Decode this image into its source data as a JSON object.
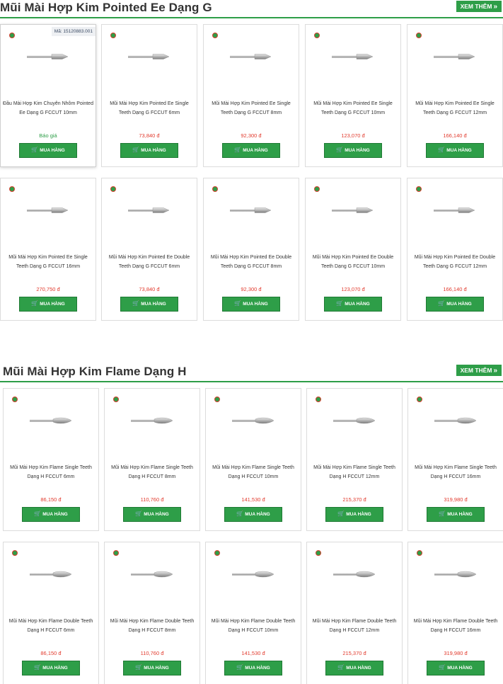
{
  "sections": [
    {
      "title": "Mũi Mài Hợp Kim Pointed Ee Dạng G",
      "see_more": "XEM THÊM",
      "products": [
        {
          "name": "Đầu Mài Hợp Kim Chuyên Nhôm Pointed Ee Dạng G FCCUT 10mm",
          "price": "Báo giá",
          "sku": "Mã: 15120883.001"
        },
        {
          "name": "Mũi Mài Hợp Kim Pointed Ee Single Teeth Dạng G FCCUT 6mm",
          "price": "73,840 đ"
        },
        {
          "name": "Mũi Mài Hợp Kim Pointed Ee Single Teeth Dạng G FCCUT 8mm",
          "price": "92,300 đ"
        },
        {
          "name": "Mũi Mài Hợp Kim Pointed Ee Single Teeth Dạng G FCCUT 10mm",
          "price": "123,070 đ"
        },
        {
          "name": "Mũi Mài Hợp Kim Pointed Ee Single Teeth Dạng G FCCUT 12mm",
          "price": "166,140 đ"
        },
        {
          "name": "Mũi Mài Hợp Kim Pointed Ee Single Teeth Dạng G FCCUT 16mm",
          "price": "270,750 đ"
        },
        {
          "name": "Mũi Mài Hợp Kim Pointed Ee Double Teeth Dạng G FCCUT 6mm",
          "price": "73,840 đ"
        },
        {
          "name": "Mũi Mài Hợp Kim Pointed Ee Double Teeth Dạng G FCCUT 8mm",
          "price": "92,300 đ"
        },
        {
          "name": "Mũi Mài Hợp Kim Pointed Ee Double Teeth Dạng G FCCUT 10mm",
          "price": "123,070 đ"
        },
        {
          "name": "Mũi Mài Hợp Kim Pointed Ee Double Teeth Dạng G FCCUT 12mm",
          "price": "166,140 đ"
        }
      ]
    },
    {
      "title": "Mũi Mài Hợp Kim Flame Dạng H",
      "see_more": "XEM THÊM",
      "products": [
        {
          "name": "Mũi Mài Hợp Kim Flame Single Teeth Dạng H FCCUT 6mm",
          "price": "86,150 đ"
        },
        {
          "name": "Mũi Mài Hợp Kim Flame Single Teeth Dạng H FCCUT 8mm",
          "price": "110,760 đ"
        },
        {
          "name": "Mũi Mài Hợp Kim Flame Single Teeth Dạng H FCCUT 10mm",
          "price": "141,530 đ"
        },
        {
          "name": "Mũi Mài Hợp Kim Flame Single Teeth Dạng H FCCUT 12mm",
          "price": "215,370 đ"
        },
        {
          "name": "Mũi Mài Hợp Kim Flame Single Teeth Dạng H FCCUT 16mm",
          "price": "319,980 đ"
        },
        {
          "name": "Mũi Mài Hợp Kim Flame Double Teeth Dạng H FCCUT 6mm",
          "price": "86,150 đ"
        },
        {
          "name": "Mũi Mài Hợp Kim Flame Double Teeth Dạng H FCCUT 8mm",
          "price": "110,760 đ"
        },
        {
          "name": "Mũi Mài Hợp Kim Flame Double Teeth Dạng H FCCUT 10mm",
          "price": "141,530 đ"
        },
        {
          "name": "Mũi Mài Hợp Kim Flame Double Teeth Dạng H FCCUT 12mm",
          "price": "215,370 đ"
        },
        {
          "name": "Mũi Mài Hợp Kim Flame Double Teeth Dạng H FCCUT 16mm",
          "price": "319,980 đ"
        }
      ]
    }
  ],
  "buy_label": "MUA HÀNG",
  "icons": {
    "see_more": "double-chevron-right-icon",
    "buy": "cart-icon",
    "brand": "brand-logo-icon",
    "product": "carbide-burr-icon"
  },
  "colors": {
    "accent": "#2e9e48",
    "price": "#e23b2e",
    "border": "#dcdcdc"
  }
}
